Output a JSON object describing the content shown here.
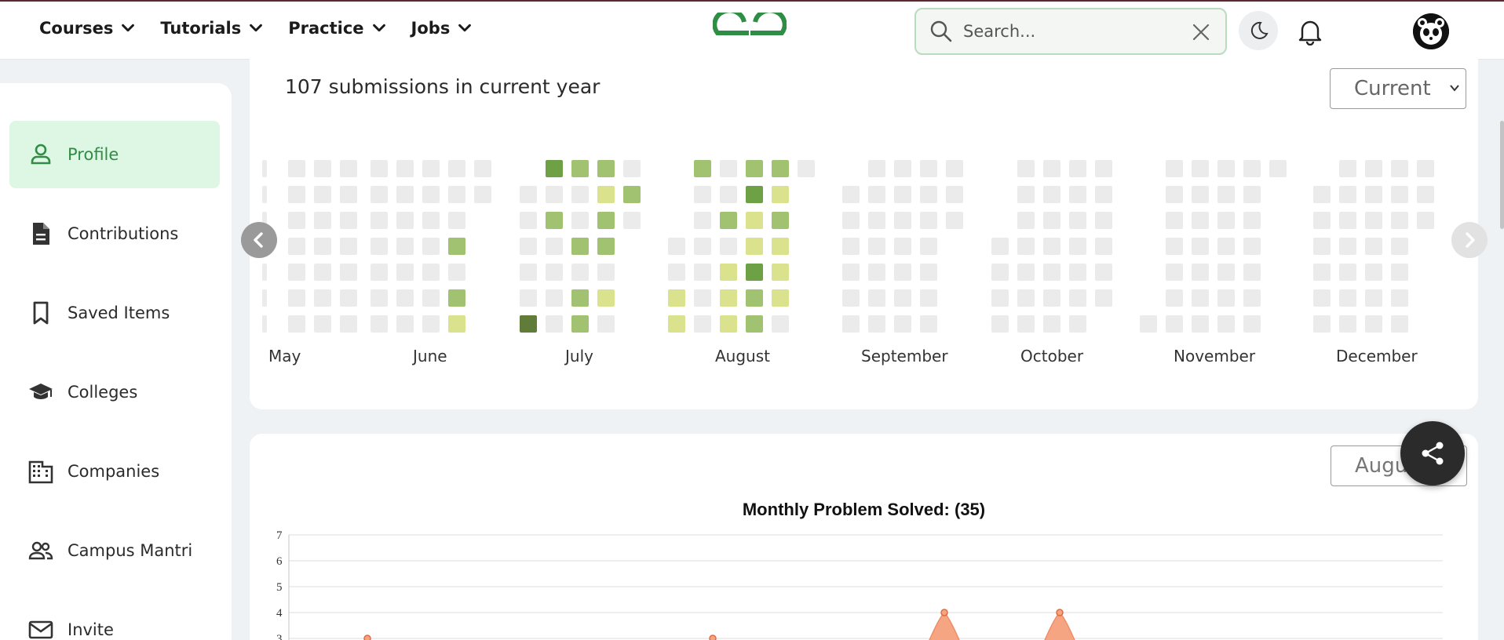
{
  "header": {
    "nav": [
      {
        "label": "Courses"
      },
      {
        "label": "Tutorials"
      },
      {
        "label": "Practice"
      },
      {
        "label": "Jobs"
      }
    ],
    "logo_icon": "gfg-logo-icon",
    "search_placeholder": "Search...",
    "icons": [
      "search-icon",
      "close-icon",
      "moon-icon",
      "bell-icon",
      "avatar-panda"
    ]
  },
  "sidebar": {
    "items": [
      {
        "label": "Profile",
        "icon": "person-icon",
        "active": true
      },
      {
        "label": "Contributions",
        "icon": "document-icon",
        "active": false
      },
      {
        "label": "Saved Items",
        "icon": "bookmark-icon",
        "active": false
      },
      {
        "label": "Colleges",
        "icon": "graduation-cap-icon",
        "active": false
      },
      {
        "label": "Companies",
        "icon": "building-icon",
        "active": false
      },
      {
        "label": "Campus Mantri",
        "icon": "people-icon",
        "active": false
      },
      {
        "label": "Invite",
        "icon": "mail-icon",
        "active": false
      }
    ]
  },
  "heatmap_card": {
    "title": "107 submissions in current year",
    "year_select": "Current",
    "months": [
      "May",
      "June",
      "July",
      "August",
      "September",
      "October",
      "November",
      "December"
    ]
  },
  "chart_card": {
    "month_select": "August",
    "chart_data": {
      "type": "area",
      "title": "Monthly Problem Solved: (35)",
      "y_ticks": [
        "7",
        "6",
        "5",
        "4",
        "3"
      ],
      "ylim": [
        0,
        7
      ],
      "visible_points": [
        3,
        3,
        4,
        4
      ]
    }
  },
  "colors": {
    "brand_green": "#2f8d46",
    "active_bg": "#def7e4",
    "empty_cell": "#ebebeb",
    "level1": "#dbe28e",
    "level2": "#a0c271",
    "level3": "#6ea146",
    "level4": "#617c38",
    "chart_fill": "#f6a583"
  }
}
